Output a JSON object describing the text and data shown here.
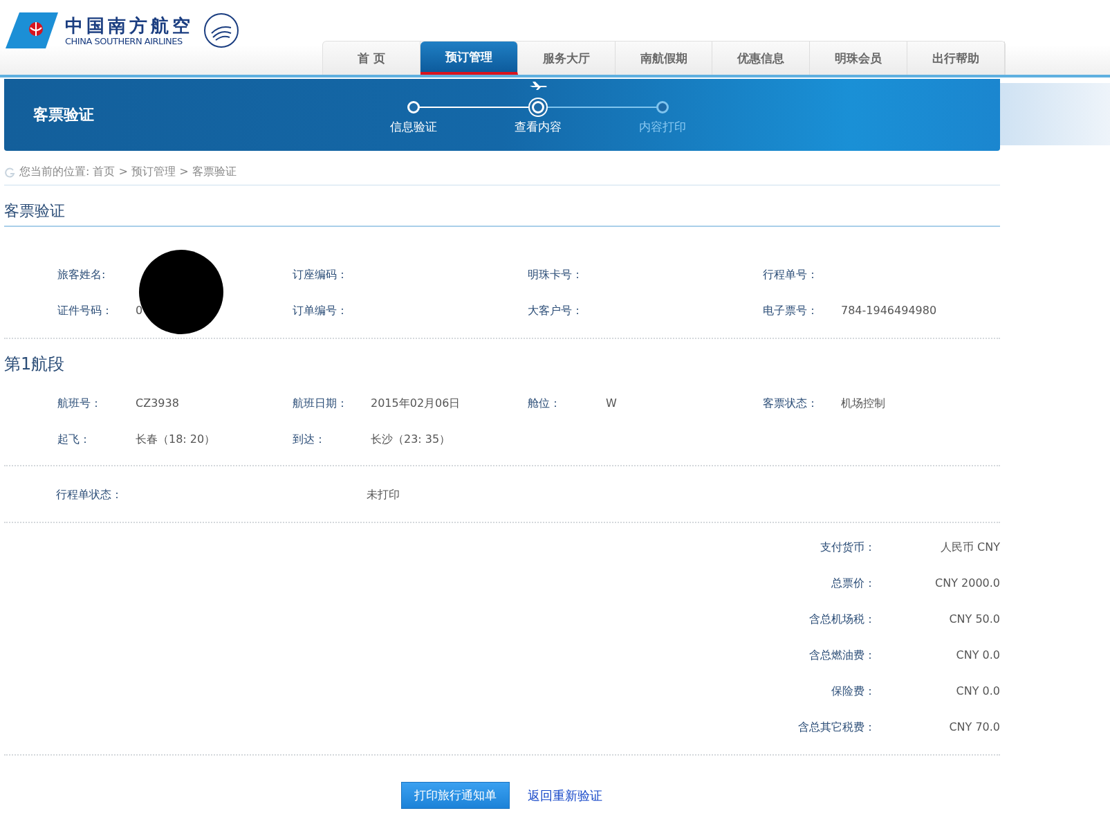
{
  "logo": {
    "name_cn": "中国南方航空",
    "name_en": "CHINA SOUTHERN AIRLINES"
  },
  "nav": [
    {
      "label": "首 页",
      "selected": false
    },
    {
      "label": "预订管理",
      "selected": true
    },
    {
      "label": "服务大厅",
      "selected": false
    },
    {
      "label": "南航假期",
      "selected": false
    },
    {
      "label": "优惠信息",
      "selected": false
    },
    {
      "label": "明珠会员",
      "selected": false
    },
    {
      "label": "出行帮助",
      "selected": false
    }
  ],
  "banner": {
    "title": "客票验证",
    "steps": [
      {
        "label": "信息验证",
        "done": true,
        "selected": false
      },
      {
        "label": "查看内容",
        "done": true,
        "selected": true
      },
      {
        "label": "内容打印",
        "done": false,
        "selected": false
      }
    ]
  },
  "breadcrumb": "您当前的位置: 首页 > 预订管理 > 客票验证",
  "section_title": "客票验证",
  "passenger_fields": [
    {
      "label": "旅客姓名:"
    },
    {
      "label": "订座编码："
    },
    {
      "label": "明珠卡号："
    },
    {
      "label": "行程单号："
    },
    {
      "label": "证件号码：",
      "value": "0"
    },
    {
      "label": "订单编号："
    },
    {
      "label": "大客户号："
    },
    {
      "label": "电子票号：",
      "value": "784-1946494980"
    }
  ],
  "segment": {
    "title": "第1航段",
    "fields": [
      {
        "label": "航班号：",
        "value": "CZ3938"
      },
      {
        "label": "航班日期：",
        "value": "2015年02月06日"
      },
      {
        "label": "舱位：",
        "value": "W"
      },
      {
        "label": "客票状态：",
        "value": "机场控制"
      },
      {
        "label": "起飞：",
        "value": "长春（18: 20）"
      },
      {
        "label": "到达：",
        "value": "长沙（23: 35）"
      }
    ]
  },
  "itinerary_status": {
    "label": "行程单状态：",
    "value": "未打印"
  },
  "fees": [
    {
      "label": "支付货币：",
      "value": "人民币 CNY"
    },
    {
      "label": "总票价：",
      "value": "CNY 2000.0"
    },
    {
      "label": "含总机场税：",
      "value": "CNY 50.0"
    },
    {
      "label": "含总燃油费：",
      "value": "CNY 0.0"
    },
    {
      "label": "保险费：",
      "value": "CNY 0.0"
    },
    {
      "label": "含总其它税费：",
      "value": "CNY 70.0"
    }
  ],
  "buttons": [
    {
      "label": "打印旅行通知单",
      "kind": "primary"
    },
    {
      "label": "返回重新验证",
      "kind": "link"
    }
  ]
}
